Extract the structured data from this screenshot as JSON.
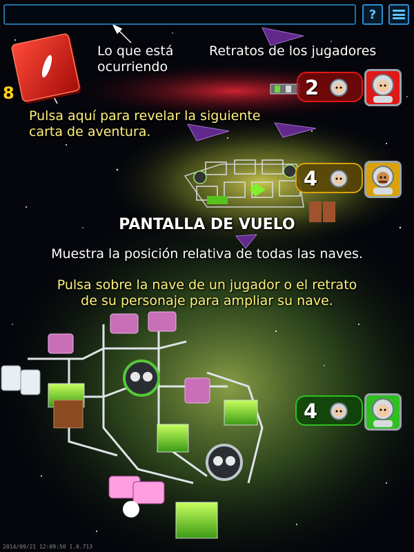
{
  "top_bar": {
    "message": "",
    "help_label": "?",
    "menu_icon": "menu-icon"
  },
  "deck": {
    "count": "8"
  },
  "tutorial": {
    "what_is_happening": "Lo que está ocurriendo",
    "portraits": "Retratos de los jugadores",
    "reveal_card": "Pulsa aquí para revelar la siguiente carta de aventura.",
    "screen_title": "PANTALLA DE VUELO",
    "description": "Muestra la posición relativa de todas las naves.",
    "tap_hint": "Pulsa sobre la nave de un jugador o el retrato de su personaje para ampliar su nave."
  },
  "players": [
    {
      "color": "red",
      "accent": "#e01818",
      "position": "2"
    },
    {
      "color": "yellow",
      "accent": "#d9a20c",
      "position": "4"
    },
    {
      "color": "green",
      "accent": "#2fbf22",
      "position": "4"
    }
  ],
  "version": "2014/09/21 12:09:50 1.0.713"
}
